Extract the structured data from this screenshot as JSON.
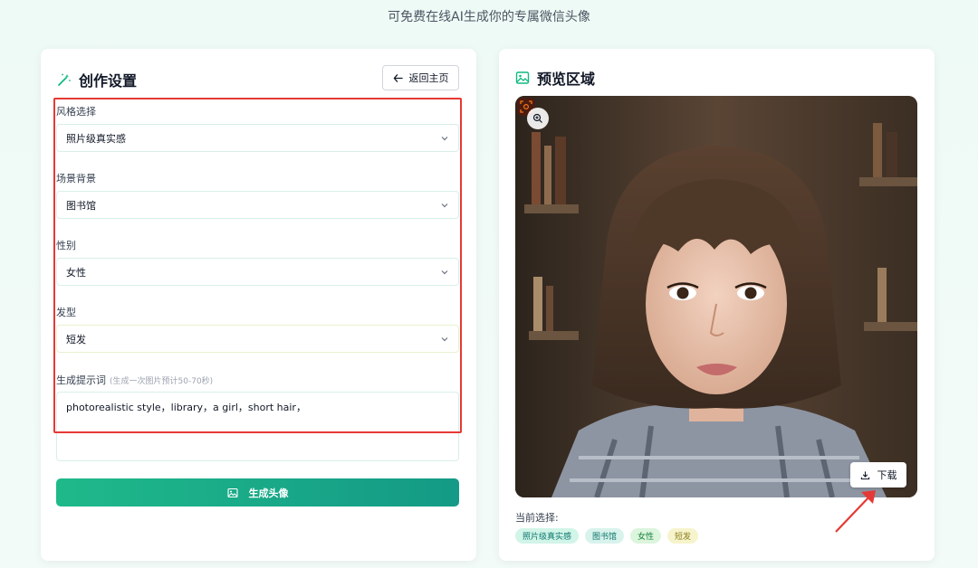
{
  "header": {
    "subtitle": "可免费在线AI生成你的专属微信头像"
  },
  "left_panel": {
    "title": "创作设置",
    "back_button": "返回主页",
    "style": {
      "label": "风格选择",
      "value": "照片级真实感"
    },
    "scene": {
      "label": "场景背景",
      "value": "图书馆"
    },
    "gender": {
      "label": "性别",
      "value": "女性"
    },
    "hair": {
      "label": "发型",
      "value": "短发"
    },
    "prompt": {
      "label": "生成提示词",
      "hint": "(生成一次图片预计50-70秒)",
      "value": "photorealistic style，library，a girl，short hair，"
    },
    "generate_button": "生成头像"
  },
  "right_panel": {
    "title": "预览区域",
    "download_button": "下载",
    "current_label": "当前选择:",
    "tags": [
      "照片级真实感",
      "图书馆",
      "女性",
      "短发"
    ]
  },
  "colors": {
    "accent": "#149a86",
    "accent_light": "#1fb98a",
    "highlight_red": "#e53935"
  }
}
